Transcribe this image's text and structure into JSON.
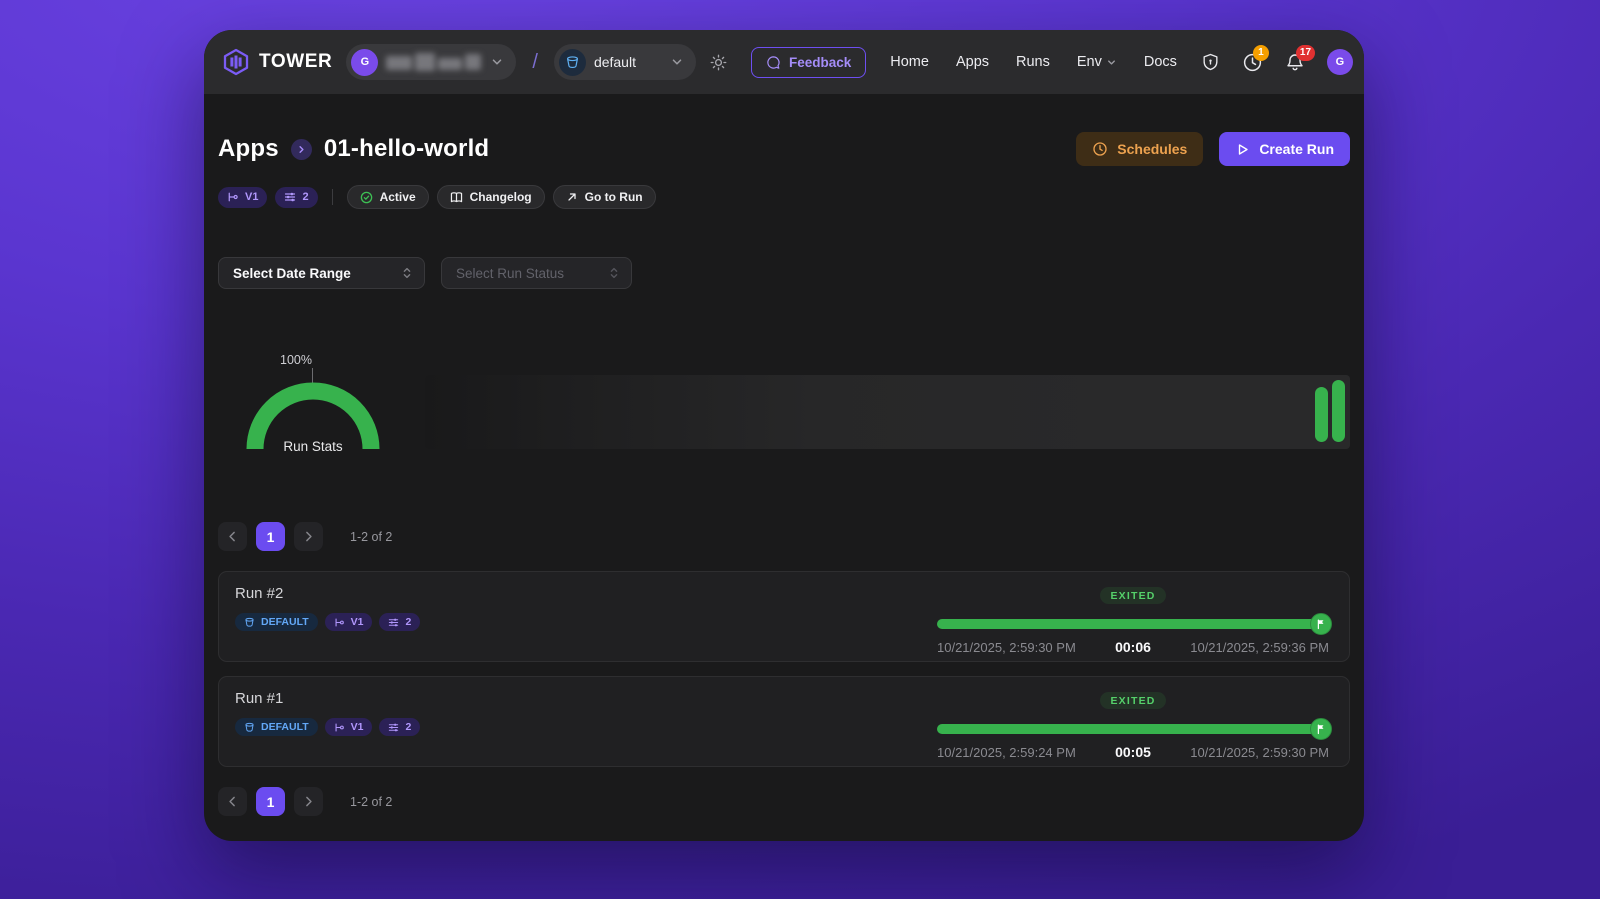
{
  "navbar": {
    "brand": "TOWER",
    "org": {
      "avatar_initial": "G"
    },
    "separator": "/",
    "environment": {
      "name": "default"
    },
    "feedback_label": "Feedback",
    "links": [
      {
        "label": "Home"
      },
      {
        "label": "Apps"
      },
      {
        "label": "Runs"
      },
      {
        "label": "Env",
        "has_dropdown": true
      },
      {
        "label": "Docs"
      }
    ],
    "clock_badge_count": "1",
    "bell_badge_count": "17",
    "user_avatar_initial": "G"
  },
  "header": {
    "breadcrumb_parent": "Apps",
    "breadcrumb_current": "01-hello-world",
    "schedules_label": "Schedules",
    "create_run_label": "Create Run"
  },
  "app_meta": {
    "version_badge": "V1",
    "params_badge": "2",
    "status_chip": "Active",
    "changelog_chip": "Changelog",
    "go_to_run_chip": "Go to Run"
  },
  "filters": {
    "date_range_placeholder": "Select Date Range",
    "run_status_placeholder": "Select Run Status"
  },
  "chart": {
    "gauge_value_label": "100%",
    "gauge_caption": "Run Stats"
  },
  "chart_data": [
    {
      "type": "gauge",
      "title": "Run Stats",
      "value_pct": 100,
      "label": "100%",
      "color": "#37b24d",
      "layout": "semicircle donut, fully filled"
    },
    {
      "type": "bar",
      "title": "Run duration timeline",
      "categories": [
        "Run #1",
        "Run #2"
      ],
      "values": [
        5,
        6
      ],
      "unit": "seconds",
      "color": "#37b24d",
      "layout": "two rounded green bars at far right edge of dark timeline strip, no axes or labels"
    }
  ],
  "pagination": {
    "prev_icon": "chevron-left",
    "page": "1",
    "next_icon": "chevron-right",
    "range_label": "1-2 of 2"
  },
  "runs": [
    {
      "title": "Run #2",
      "env_badge": "DEFAULT",
      "version_badge": "V1",
      "params_badge": "2",
      "status": "EXITED",
      "start_time": "10/21/2025, 2:59:30 PM",
      "duration": "00:06",
      "end_time": "10/21/2025, 2:59:36 PM",
      "progress_pct": 100
    },
    {
      "title": "Run #1",
      "env_badge": "DEFAULT",
      "version_badge": "V1",
      "params_badge": "2",
      "status": "EXITED",
      "start_time": "10/21/2025, 2:59:24 PM",
      "duration": "00:05",
      "end_time": "10/21/2025, 2:59:30 PM",
      "progress_pct": 100
    }
  ],
  "icons": {
    "tower-logo-icon": "purple hexagon with tower bars",
    "bucket-icon": "blue bucket",
    "sun-icon": "theme toggle sun",
    "chat-bubble-icon": "feedback speech bubble",
    "shield-icon": "security shield with keyhole",
    "clock-icon": "history clock",
    "bell-icon": "notifications bell",
    "branch-icon": "version branch",
    "params-icon": "parameter sliders",
    "check-circle-icon": "active status check",
    "book-icon": "changelog book",
    "arrow-up-right-icon": "external go-to arrow",
    "play-icon": "create run play triangle",
    "flag-icon": "run finished flag",
    "chevrons-up-down-icon": "select control"
  },
  "colors": {
    "desktop_purple": "#5a35cf",
    "app_bg": "#1a1a1b",
    "navbar_bg": "#2b2b2d",
    "accent_purple": "#6b4cf0",
    "badge_purple_bg": "#2b2156",
    "badge_purple_text": "#b197fc",
    "green": "#37b24d",
    "exited_text": "#55d06a",
    "schedules_orange": "#eda24f",
    "default_blue": "#63a8f7",
    "notification_orange": "#f59f00",
    "notification_red": "#e03131"
  }
}
